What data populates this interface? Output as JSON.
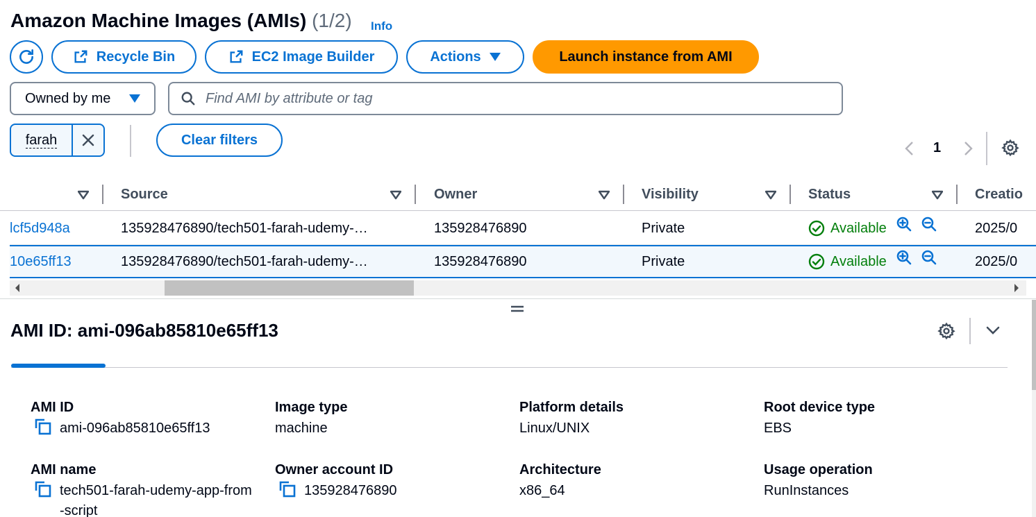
{
  "header": {
    "title": "Amazon Machine Images (AMIs)",
    "count": "(1/2)",
    "info": "Info"
  },
  "toolbar": {
    "recycle_bin": "Recycle Bin",
    "image_builder": "EC2 Image Builder",
    "actions": "Actions",
    "launch": "Launch instance from AMI"
  },
  "filters": {
    "owner_select": "Owned by me",
    "search_placeholder": "Find AMI by attribute or tag",
    "token": "farah",
    "clear": "Clear filters"
  },
  "pagination": {
    "page": "1"
  },
  "table": {
    "columns": [
      "Source",
      "Owner",
      "Visibility",
      "Status",
      "Creatio"
    ],
    "rows": [
      {
        "id": "lcf5d948a",
        "source": "135928476890/tech501-farah-udemy-…",
        "owner": "135928476890",
        "visibility": "Private",
        "status": "Available",
        "creation": "2025/0"
      },
      {
        "id": "10e65ff13",
        "source": "135928476890/tech501-farah-udemy-…",
        "owner": "135928476890",
        "visibility": "Private",
        "status": "Available",
        "creation": "2025/0"
      }
    ]
  },
  "details": {
    "title": "AMI ID: ami-096ab85810e65ff13",
    "fields": {
      "ami_id": {
        "label": "AMI ID",
        "value": "ami-096ab85810e65ff13"
      },
      "image_type": {
        "label": "Image type",
        "value": "machine"
      },
      "platform": {
        "label": "Platform details",
        "value": "Linux/UNIX"
      },
      "root_device": {
        "label": "Root device type",
        "value": "EBS"
      },
      "ami_name": {
        "label": "AMI name",
        "value": "tech501-farah-udemy-app-from-script"
      },
      "owner_account": {
        "label": "Owner account ID",
        "value": "135928476890"
      },
      "architecture": {
        "label": "Architecture",
        "value": "x86_64"
      },
      "usage_operation": {
        "label": "Usage operation",
        "value": "RunInstances"
      }
    }
  },
  "colors": {
    "link_blue": "#0972d3",
    "launch_orange": "#ff9900",
    "success_green": "#037f0c"
  },
  "icons": [
    "refresh-icon",
    "external-link-icon",
    "caret-down-icon",
    "search-icon",
    "close-icon",
    "chevron-left-icon",
    "chevron-right-icon",
    "settings-icon",
    "sort-icon",
    "status-check-icon",
    "zoom-in-icon",
    "zoom-out-icon",
    "copy-icon",
    "drag-handle-icon",
    "chevron-down-icon"
  ]
}
